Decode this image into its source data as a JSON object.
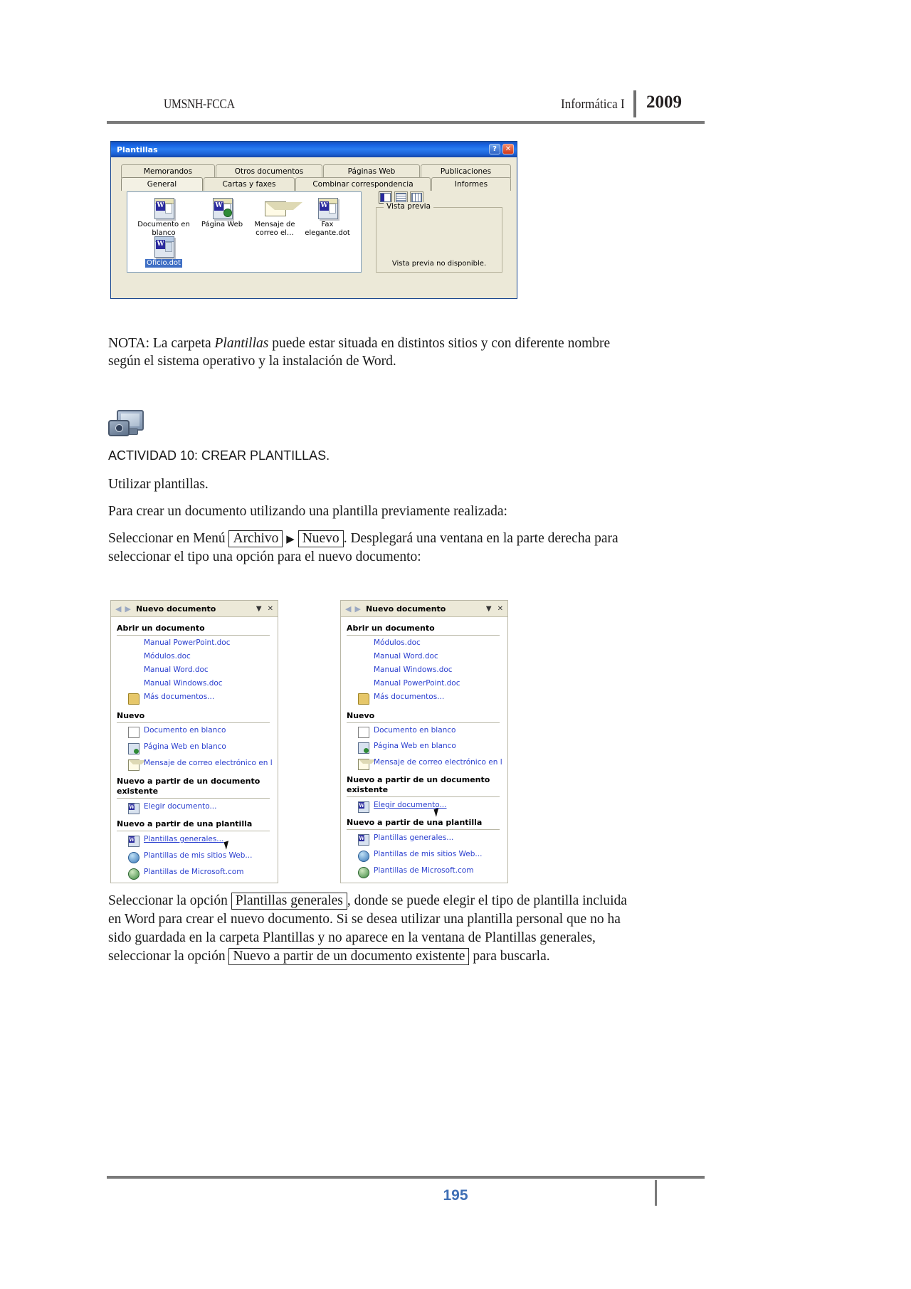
{
  "header": {
    "left": "UMSNH-FCCA",
    "course": "Informática I",
    "year": "2009"
  },
  "dialog": {
    "title": "Plantillas",
    "help_button": "?",
    "close_button": "✕",
    "tabs_row1": [
      "Memorandos",
      "Otros documentos",
      "Páginas Web",
      "Publicaciones"
    ],
    "tabs_row2": [
      "General",
      "Cartas y faxes",
      "Combinar correspondencia",
      "Informes"
    ],
    "selected_tab": "General",
    "templates": [
      {
        "label": "Documento en blanco",
        "icon": "word-document-icon",
        "selected": false
      },
      {
        "label": "Página Web",
        "icon": "web-page-icon",
        "selected": false
      },
      {
        "label": "Mensaje de correo el…",
        "icon": "envelope-icon",
        "selected": false
      },
      {
        "label": "Fax elegante.dot",
        "icon": "word-document-icon",
        "selected": false
      },
      {
        "label": "Oficio.dot",
        "icon": "word-document-icon",
        "selected": true
      }
    ],
    "view_buttons": [
      "large-icons-view-icon",
      "list-view-icon",
      "details-view-icon"
    ],
    "preview_group_label": "Vista previa",
    "preview_message": "Vista previa no disponible."
  },
  "body": {
    "note_p1": "NOTA: La carpeta ",
    "note_italic": "Plantillas",
    "note_p2": " puede estar situada en distintos sitios y con diferente nombre",
    "note_line2": "según el sistema operativo y la instalación de Word.",
    "activity_title": "ACTIVIDAD 10: CREAR PLANTILLAS.",
    "activity_subtitle": "Utilizar plantillas.",
    "intro": "Para crear un documento utilizando una plantilla previamente realizada:",
    "select_prefix": "Seleccionar en Menú",
    "menu_archivo": "Archivo",
    "menu_arrow": "▶",
    "menu_nuevo": "Nuevo",
    "select_suffix": ". Desplegará una ventana en la parte derecha para",
    "select_line2": "seleccionar el tipo una opción para el nuevo documento:",
    "closing_1": "Seleccionar la opción",
    "closing_box1": "Plantillas generales",
    "closing_2": ", donde se puede elegir el tipo de plantilla incluida",
    "closing_3": "en Word para crear el nuevo documento. Si se desea utilizar una plantilla personal que no ha",
    "closing_4": "sido guardada en la carpeta Plantillas y no aparece en la ventana de Plantillas generales,",
    "closing_5": "seleccionar la opción",
    "closing_box2": "Nuevo a partir de un documento existente",
    "closing_6": "para buscarla."
  },
  "taskpane_left": {
    "title": "Nuevo documento",
    "back_arrow": "◀",
    "forward_arrow": "▶",
    "dropdown": "▼",
    "close": "✕",
    "section_open": "Abrir un documento",
    "open_items": [
      "Manual PowerPoint.doc",
      "Módulos.doc",
      "Manual Word.doc",
      "Manual Windows.doc"
    ],
    "more_documents": "Más documentos...",
    "section_new": "Nuevo",
    "new_items": [
      "Documento en blanco",
      "Página Web en blanco",
      "Mensaje de correo electrónico en l"
    ],
    "section_from_existing_l1": "Nuevo a partir de un documento",
    "section_from_existing_l2": "existente",
    "choose_document": "Elegir documento...",
    "section_from_template": "Nuevo a partir de una plantilla",
    "template_items": [
      "Plantillas generales...",
      "Plantillas de mis sitios Web...",
      "Plantillas de Microsoft.com"
    ],
    "highlighted_item": "Plantillas generales..."
  },
  "taskpane_right": {
    "title": "Nuevo documento",
    "back_arrow": "◀",
    "forward_arrow": "▶",
    "dropdown": "▼",
    "close": "✕",
    "section_open": "Abrir un documento",
    "open_items": [
      "Módulos.doc",
      "Manual Word.doc",
      "Manual Windows.doc",
      "Manual PowerPoint.doc"
    ],
    "more_documents": "Más documentos...",
    "section_new": "Nuevo",
    "new_items": [
      "Documento en blanco",
      "Página Web en blanco",
      "Mensaje de correo electrónico en l"
    ],
    "section_from_existing_l1": "Nuevo a partir de un documento",
    "section_from_existing_l2": "existente",
    "choose_document": "Elegir documento...",
    "section_from_template": "Nuevo a partir de una plantilla",
    "template_items": [
      "Plantillas generales...",
      "Plantillas de mis sitios Web...",
      "Plantillas de Microsoft.com"
    ],
    "highlighted_item": "Elegir documento..."
  },
  "footer": {
    "page_number": "195"
  }
}
